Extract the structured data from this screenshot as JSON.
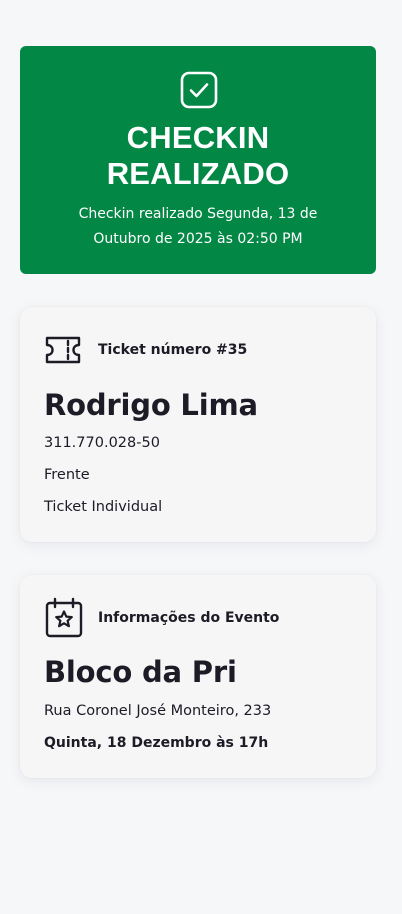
{
  "banner": {
    "title_line1": "CHECKIN",
    "title_line2": "REALIZADO",
    "subtitle_line1": "Checkin realizado Segunda, 13 de",
    "subtitle_line2": "Outubro de 2025 às 02:50 PM",
    "icon": "checkbox-check-icon",
    "color": "#028745"
  },
  "ticket": {
    "icon": "ticket-icon",
    "label": "Ticket número #35",
    "name": "Rodrigo Lima",
    "document": "311.770.028-50",
    "sector": "Frente",
    "type": "Ticket Individual"
  },
  "event": {
    "icon": "calendar-star-icon",
    "label": "Informações do Evento",
    "name": "Bloco da Pri",
    "address": "Rua Coronel José Monteiro, 233",
    "datetime": "Quinta, 18 Dezembro às 17h"
  }
}
